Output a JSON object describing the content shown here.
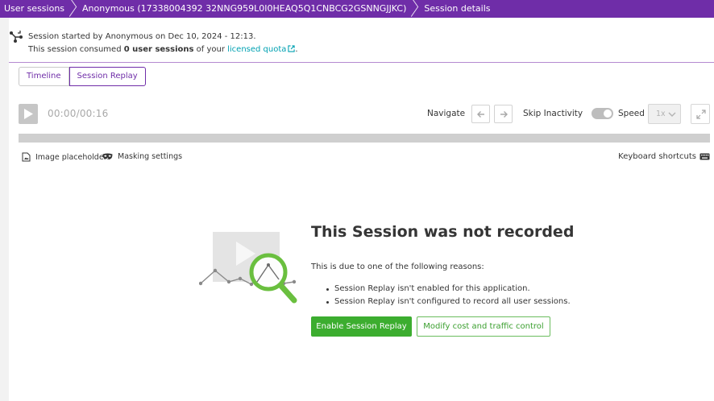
{
  "breadcrumb": {
    "items": [
      {
        "label": "User sessions"
      },
      {
        "label": "Anonymous (17338004392 32NNG959L0I0HEAQ5Q1CNBCG2GSNNGJJKC)"
      },
      {
        "label": "Session details"
      }
    ]
  },
  "session_info": {
    "started_text": "Session started by Anonymous on Dec 10, 2024 - 12:13.",
    "consumed_prefix": "This session consumed ",
    "consumed_value": "0 user sessions",
    "consumed_middle": " of your ",
    "quota_link": "licensed quota",
    "consumed_suffix": "."
  },
  "tabs": [
    {
      "label": "Timeline",
      "active": false
    },
    {
      "label": "Session Replay",
      "active": true
    }
  ],
  "player": {
    "timecode": "00:00/00:16",
    "navigate_label": "Navigate",
    "skip_inactivity_label": "Skip Inactivity",
    "skip_inactivity_enabled": true,
    "speed_label": "Speed",
    "speed_value": "1x"
  },
  "toolbar": {
    "image_placeholders": "Image placeholders",
    "masking_settings": "Masking settings",
    "keyboard_shortcuts": "Keyboard shortcuts"
  },
  "empty_state": {
    "title": "This Session was not recorded",
    "intro": "This is due to one of the following reasons:",
    "reasons": [
      "Session Replay isn't enabled for this application.",
      "Session Replay isn't configured to record all user sessions."
    ],
    "primary_button": "Enable Session Replay",
    "secondary_button": "Modify cost and traffic control"
  },
  "colors": {
    "brand_purple": "#6f2da8",
    "link_teal": "#00a1b2",
    "success_green": "#3cad2f"
  }
}
